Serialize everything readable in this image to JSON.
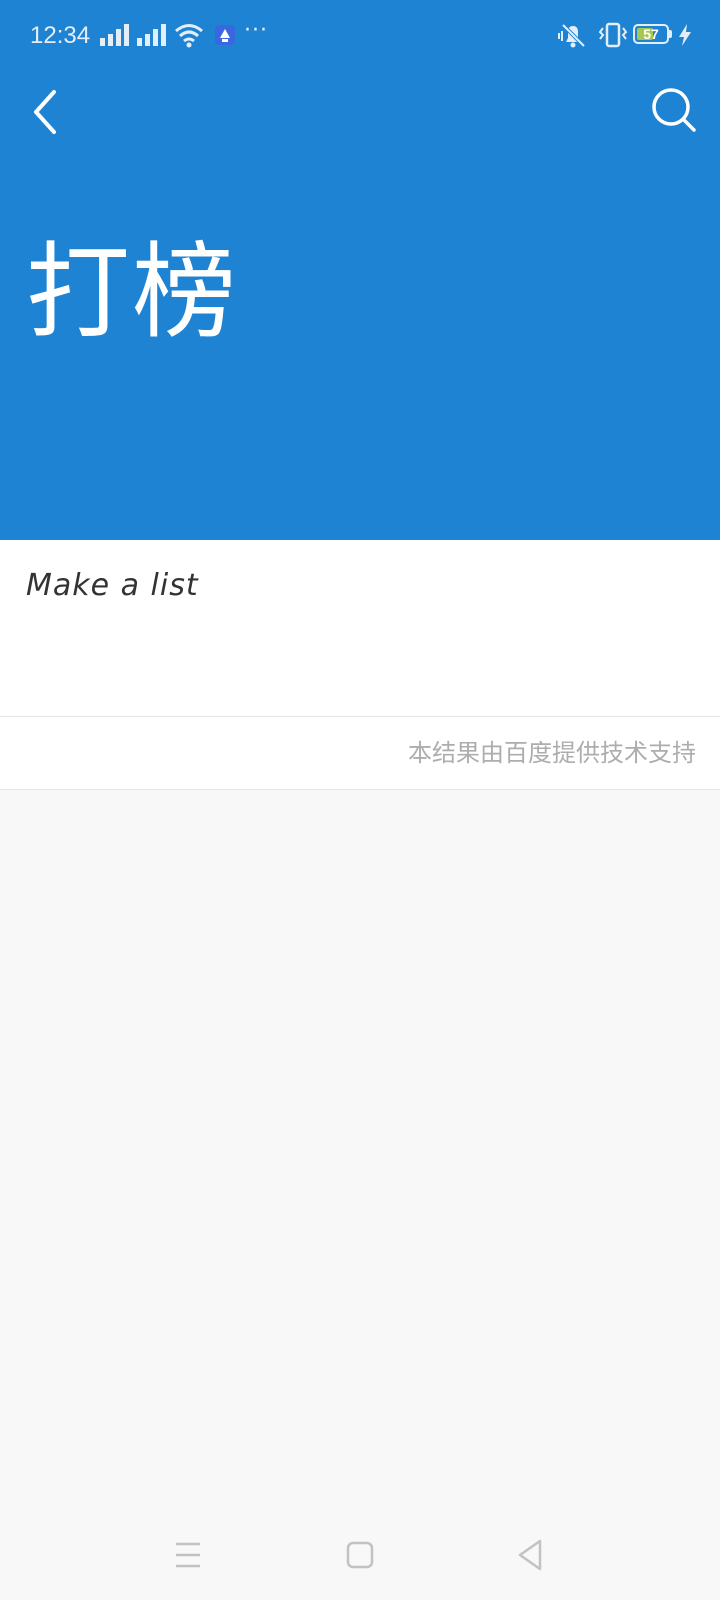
{
  "status_bar": {
    "time": "12:34",
    "icons": [
      "signal-icon",
      "signal-icon",
      "wifi-icon",
      "app-notification-icon",
      "more-dots-icon",
      "mute-icon",
      "vibrate-icon",
      "battery-icon",
      "charging-icon"
    ],
    "more_indicator": "···",
    "battery_level": "57",
    "battery_percent": 57
  },
  "app_bar": {
    "back_icon": "chevron-left-icon",
    "search_icon": "search-icon"
  },
  "header": {
    "title": "打榜",
    "background_color": "#1f83d3"
  },
  "card": {
    "text": "Make a list"
  },
  "footer": {
    "note": "本结果由百度提供技术支持"
  },
  "nav_bar": {
    "icons": [
      "menu-icon",
      "home-icon",
      "back-triangle-icon"
    ]
  }
}
